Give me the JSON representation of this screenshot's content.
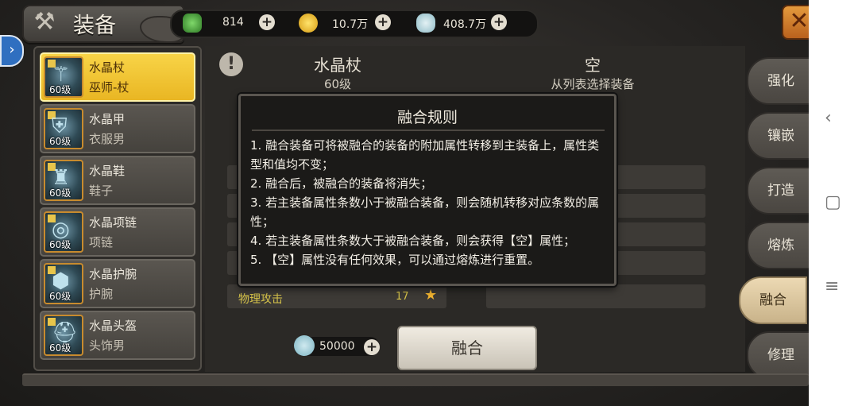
{
  "header": {
    "title": "装备",
    "resources": [
      {
        "icon": "green-gem-icon",
        "value": "814"
      },
      {
        "icon": "gold-coin-icon",
        "value": "10.7万"
      },
      {
        "icon": "silver-shell-icon",
        "value": "408.7万"
      }
    ],
    "plus_symbol": "+",
    "close_symbol": "✕"
  },
  "items": [
    {
      "name": "水晶杖",
      "type": "巫师-杖",
      "level": "60级",
      "selected": true
    },
    {
      "name": "水晶甲",
      "type": "衣服男",
      "level": "60级"
    },
    {
      "name": "水晶鞋",
      "type": "鞋子",
      "level": "60级"
    },
    {
      "name": "水晶项链",
      "type": "项链",
      "level": "60级"
    },
    {
      "name": "水晶护腕",
      "type": "护腕",
      "level": "60级"
    },
    {
      "name": "水晶头盔",
      "type": "头饰男",
      "level": "60级"
    }
  ],
  "main": {
    "info_symbol": "!",
    "main_item": {
      "name": "水晶杖",
      "level": "60级"
    },
    "sub_item": {
      "name": "空",
      "hint": "从列表选择装备"
    },
    "visible_attr": {
      "name": "物理攻击",
      "value": "17"
    },
    "cost": "50000",
    "fuse_button": "融合"
  },
  "tabs": [
    "强化",
    "镶嵌",
    "打造",
    "熔炼",
    "融合",
    "修理"
  ],
  "active_tab": "融合",
  "popup": {
    "title": "融合规则",
    "lines": [
      "1. 融合装备可将被融合的装备的附加属性转移到主装备上，属性类型和值均不变；",
      "2. 融合后，被融合的装备将消失；",
      "3. 若主装备属性条数小于被融合装备，则会随机转移对应条数的属性；",
      "4. 若主装备属性条数大于被融合装备，则会获得【空】属性；",
      "5. 【空】属性没有任何效果，可以通过熔炼进行重置。"
    ]
  },
  "colors": {
    "selected_item": "#f2c83a",
    "attribute_text": "#d7c44a",
    "close_button": "#d9822f"
  }
}
